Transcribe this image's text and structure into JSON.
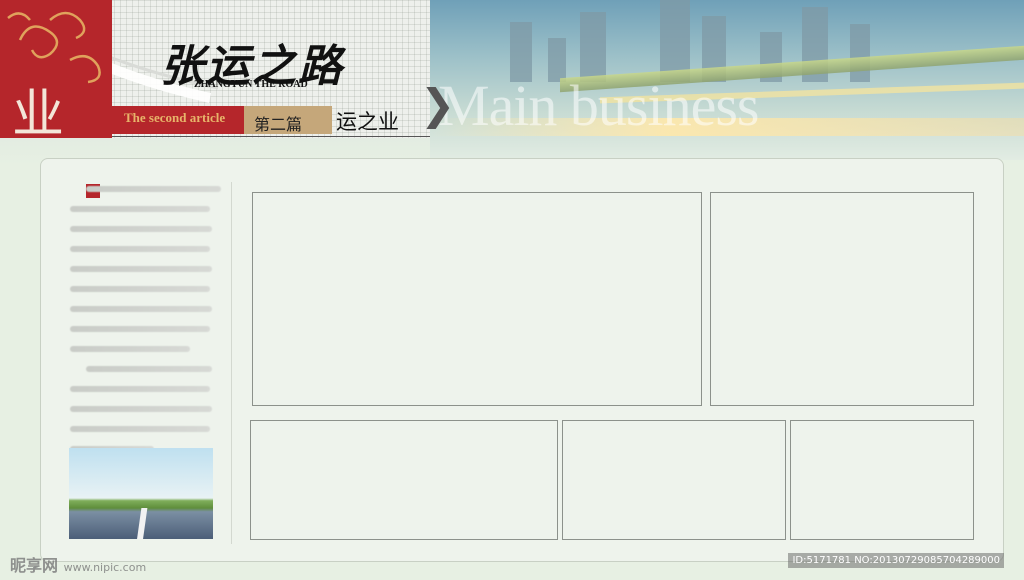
{
  "header": {
    "calligraphy_title": "张运之路",
    "subtitle_en": "ZHANGYUN THE ROAD",
    "side_char": "业",
    "article_en": "The second article",
    "article_cn": "第二篇",
    "section_title": "运之业",
    "background_word": "Main business",
    "chevron": "❯"
  },
  "sidebar": {
    "paragraph_lines": 13,
    "image": "road-photo"
  },
  "frames": 5,
  "footer": {
    "brand": "昵享网",
    "site": "www.nipic.com",
    "id_text": "ID:5171781 NO:20130729085704289000"
  },
  "colors": {
    "brand_red": "#b5262b",
    "tan": "#c5a77a",
    "page_bg": "#e7f0e3"
  }
}
